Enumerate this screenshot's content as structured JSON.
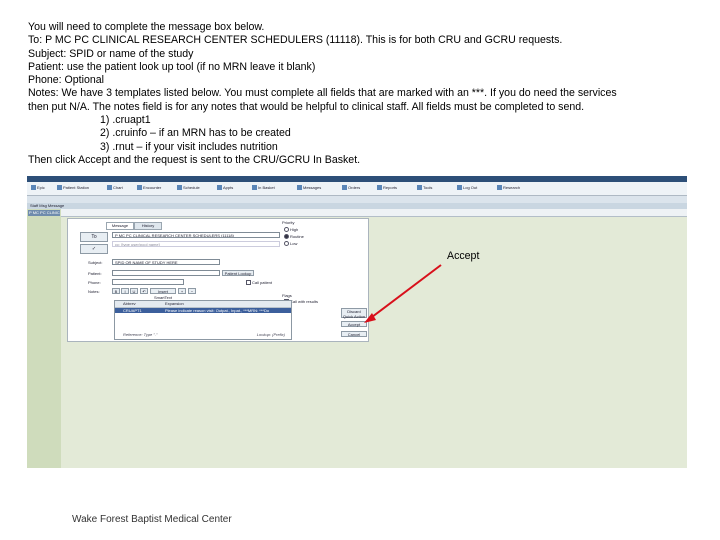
{
  "instructions": {
    "line1": "You will need to complete the message box below.",
    "line2": "To: P MC PC CLINICAL RESEARCH CENTER SCHEDULERS (11118).  This is for both CRU and GCRU requests.",
    "line3": "Subject: SPID or name of the study",
    "line4": "Patient: use the patient look up tool (if no MRN leave it blank)",
    "line5": "Phone: Optional",
    "line6": "Notes: We have 3 templates listed below.  You must complete all fields that are marked with an ***.  If you do need the services",
    "line7": "then put N/A.  The notes field is for any notes that would be helpful to clinical staff.  All fields must be completed to send.",
    "template1": "1) .cruapt1",
    "template2": "2) .cruinfo – if an MRN has to be created",
    "template3": "3) .rnut – if your visit includes nutrition",
    "line8": "Then click Accept and the request is sent to the CRU/GCRU In Basket."
  },
  "screenshot": {
    "toolbar": [
      "Epic",
      "Patient Station",
      "Chart",
      "Encounter",
      "Schedule",
      "Appts",
      "In Basket",
      "Messages",
      "Orders",
      "Reports",
      "Tools",
      "Log Out",
      "Research"
    ],
    "action_bar": "Staff Msg Message",
    "left_tab": "P MC PC CLINIC",
    "tabs": [
      "Message",
      "History"
    ],
    "to_button": "To",
    "check_button": "✓",
    "to_value": "P MC PC CLINICAL RESEARCH CENTER SCHEDULERS (11118)",
    "cc_value": "cc: [type user/pool name]",
    "subject_label": "Subject:",
    "subject_value": "SPID OR NAME OF STUDY HERE",
    "patient_label": "Patient:",
    "patient_lookup": "Patient Lookup",
    "phone_label": "Phone:",
    "notes_label": "Notes:",
    "priority_label": "Priority",
    "priority_options": [
      "High",
      "Routine",
      "Low"
    ],
    "call_label": "Call patient",
    "flags_label": "Flags",
    "flag_option": "Call with results",
    "ins_label": "Insert SmartText",
    "table_headers": [
      "Abbrev",
      "Expansion"
    ],
    "table_row": [
      "CRUAPT1",
      "Please indicate reason visit: Outpat., Inpat., ***MRN: ***Do"
    ],
    "table_footer_left": "Reference: Type \".\"",
    "table_footer_right": "Lookup: (Prefix)",
    "side_buttons": [
      "Discard Quick Action",
      "Accept",
      "Cancel"
    ]
  },
  "callout": "Accept",
  "footer": "Wake Forest Baptist Medical Center",
  "colors": {
    "titlebar": "#2d4f78",
    "highlight": "#3c5f9c",
    "arrow": "#d8101b",
    "background": "#e3ead7"
  }
}
